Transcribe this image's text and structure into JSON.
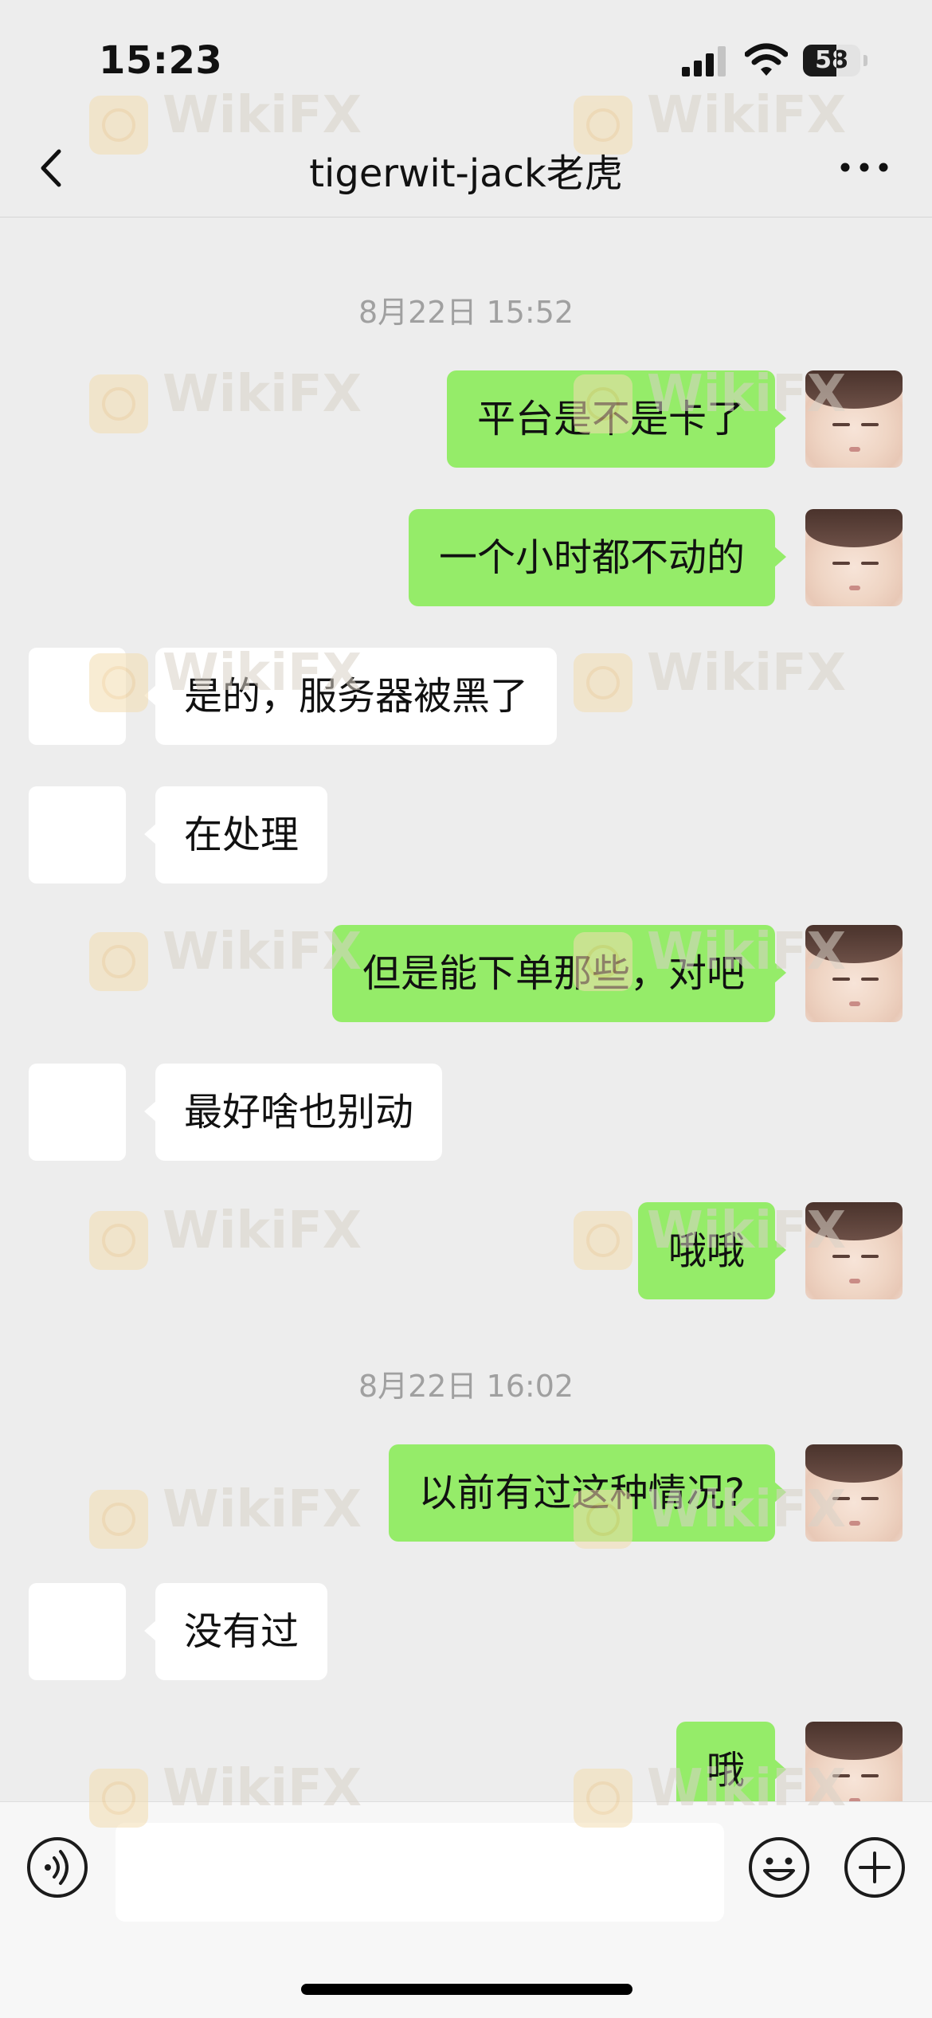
{
  "status_bar": {
    "time": "15:23",
    "battery": "58",
    "battery_level": 0.58
  },
  "header": {
    "title": "tigerwit-jack老虎"
  },
  "chat": {
    "timestamps": [
      "8月22日 15:52",
      "8月22日 16:02"
    ],
    "messages": [
      {
        "side": "self",
        "text": "平台是不是卡了"
      },
      {
        "side": "self",
        "text": "一个小时都不动的"
      },
      {
        "side": "other",
        "text": "是的，服务器被黑了"
      },
      {
        "side": "other",
        "text": "在处理"
      },
      {
        "side": "self",
        "text": "但是能下单那些，对吧"
      },
      {
        "side": "other",
        "text": "最好啥也别动"
      },
      {
        "side": "self",
        "text": "哦哦"
      },
      {
        "side": "self",
        "text": "以前有过这种情况?"
      },
      {
        "side": "other",
        "text": "没有过"
      },
      {
        "side": "self",
        "text": "哦"
      }
    ]
  },
  "watermark": {
    "text": "WikiFX"
  },
  "colors": {
    "self_bubble": "#95ec69",
    "other_bubble": "#ffffff",
    "background": "#ededed"
  },
  "input_bar": {
    "icons": [
      "voice-icon",
      "emoji-icon",
      "plus-icon"
    ]
  }
}
